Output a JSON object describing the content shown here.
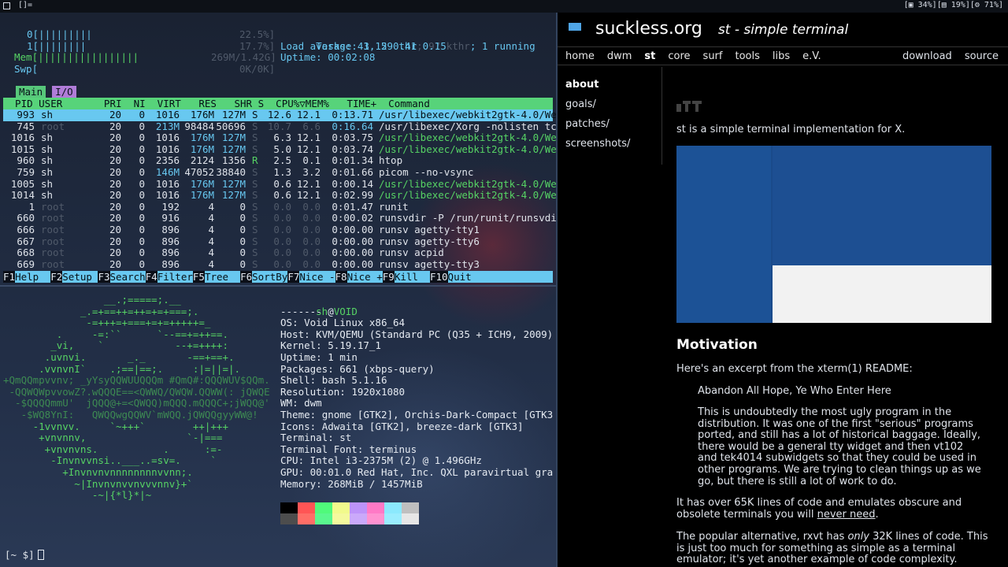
{
  "topbar": {
    "tag_label": "[]=",
    "status": "[▣ 34%][▤ 19%][⚙ 71%]"
  },
  "htop": {
    "cpu0": "0[|||||||||",
    "cpu0_val": "22.5%]",
    "cpu1": "1[||||||||",
    "cpu1_val": "17.7%]",
    "mem": "Mem[|||||||||||||||||",
    "mem_val": "269M/1.42G]",
    "swp": "Swp[",
    "swp_val": "0K/0K]",
    "tasks": "Tasks: 43, 29 thr",
    "tasks_dim": "; 97 kthr",
    "tasks_run": "; 1 running",
    "load": "Load average: 1.15 0.41 0.15",
    "uptime": "Uptime: 00:02:08",
    "tab_main": "Main",
    "tab_io": "I/O",
    "header": "  PID USER       PRI  NI  VIRT   RES   SHR S  CPU%▽MEM%   TIME+  Command",
    "rows": [
      {
        "pid": "993",
        "user": "sh",
        "pri": "20",
        "ni": "0",
        "virt": "1016",
        "res": "176M",
        "shr": "127M",
        "s": "S",
        "cpu": "12.6",
        "mem": "12.1",
        "time": "0:13.71",
        "cmd": "/usr/libexec/webkit2gtk-4.0/We",
        "sel": true
      },
      {
        "pid": "745",
        "user": "root",
        "pri": "20",
        "ni": "0",
        "virt": "213M",
        "res": "98484",
        "shr": "50696",
        "s": "S",
        "cpu": "10.7",
        "mem": "6.6",
        "time": "0:16.64",
        "cmd": "/usr/libexec/Xorg -nolisten tc"
      },
      {
        "pid": "1016",
        "user": "sh",
        "pri": "20",
        "ni": "0",
        "virt": "1016",
        "res": "176M",
        "shr": "127M",
        "s": "S",
        "cpu": "6.3",
        "mem": "12.1",
        "time": "0:03.75",
        "cmd": "/usr/libexec/webkit2gtk-4.0/We"
      },
      {
        "pid": "1015",
        "user": "sh",
        "pri": "20",
        "ni": "0",
        "virt": "1016",
        "res": "176M",
        "shr": "127M",
        "s": "S",
        "cpu": "5.0",
        "mem": "12.1",
        "time": "0:03.74",
        "cmd": "/usr/libexec/webkit2gtk-4.0/We"
      },
      {
        "pid": "960",
        "user": "sh",
        "pri": "20",
        "ni": "0",
        "virt": "2356",
        "res": "2124",
        "shr": "1356",
        "s": "R",
        "cpu": "2.5",
        "mem": "0.1",
        "time": "0:01.34",
        "cmd": "htop"
      },
      {
        "pid": "759",
        "user": "sh",
        "pri": "20",
        "ni": "0",
        "virt": "146M",
        "res": "47052",
        "shr": "38840",
        "s": "S",
        "cpu": "1.3",
        "mem": "3.2",
        "time": "0:01.66",
        "cmd": "picom --no-vsync"
      },
      {
        "pid": "1005",
        "user": "sh",
        "pri": "20",
        "ni": "0",
        "virt": "1016",
        "res": "176M",
        "shr": "127M",
        "s": "S",
        "cpu": "0.6",
        "mem": "12.1",
        "time": "0:00.14",
        "cmd": "/usr/libexec/webkit2gtk-4.0/We"
      },
      {
        "pid": "1014",
        "user": "sh",
        "pri": "20",
        "ni": "0",
        "virt": "1016",
        "res": "176M",
        "shr": "127M",
        "s": "S",
        "cpu": "0.6",
        "mem": "12.1",
        "time": "0:02.99",
        "cmd": "/usr/libexec/webkit2gtk-4.0/We"
      },
      {
        "pid": "1",
        "user": "root",
        "pri": "20",
        "ni": "0",
        "virt": "192",
        "res": "4",
        "shr": "0",
        "s": "S",
        "cpu": "0.0",
        "mem": "0.0",
        "time": "0:01.47",
        "cmd": "runit"
      },
      {
        "pid": "660",
        "user": "root",
        "pri": "20",
        "ni": "0",
        "virt": "916",
        "res": "4",
        "shr": "0",
        "s": "S",
        "cpu": "0.0",
        "mem": "0.0",
        "time": "0:00.02",
        "cmd": "runsvdir -P /run/runit/runsvdi"
      },
      {
        "pid": "666",
        "user": "root",
        "pri": "20",
        "ni": "0",
        "virt": "896",
        "res": "4",
        "shr": "0",
        "s": "S",
        "cpu": "0.0",
        "mem": "0.0",
        "time": "0:00.00",
        "cmd": "runsv agetty-tty1"
      },
      {
        "pid": "667",
        "user": "root",
        "pri": "20",
        "ni": "0",
        "virt": "896",
        "res": "4",
        "shr": "0",
        "s": "S",
        "cpu": "0.0",
        "mem": "0.0",
        "time": "0:00.00",
        "cmd": "runsv agetty-tty6"
      },
      {
        "pid": "668",
        "user": "root",
        "pri": "20",
        "ni": "0",
        "virt": "896",
        "res": "4",
        "shr": "0",
        "s": "S",
        "cpu": "0.0",
        "mem": "0.0",
        "time": "0:00.00",
        "cmd": "runsv acpid"
      },
      {
        "pid": "669",
        "user": "root",
        "pri": "20",
        "ni": "0",
        "virt": "896",
        "res": "4",
        "shr": "0",
        "s": "S",
        "cpu": "0.0",
        "mem": "0.0",
        "time": "0:00.00",
        "cmd": "runsv agetty-tty3"
      }
    ],
    "fkeys": [
      {
        "k": "F1",
        "l": "Help  "
      },
      {
        "k": "F2",
        "l": "Setup "
      },
      {
        "k": "F3",
        "l": "Search"
      },
      {
        "k": "F4",
        "l": "Filter"
      },
      {
        "k": "F5",
        "l": "Tree  "
      },
      {
        "k": "F6",
        "l": "SortBy"
      },
      {
        "k": "F7",
        "l": "Nice -"
      },
      {
        "k": "F8",
        "l": "Nice +"
      },
      {
        "k": "F9",
        "l": "Kill  "
      },
      {
        "k": "F10",
        "l": "Quit"
      }
    ]
  },
  "neofetch": {
    "logo": [
      "                 __.;=====;.__",
      "             _.=+==++=++=+=+===;.",
      "              -=+++=+===+=+=+++++=_",
      "         .     -=:``      `--==+=++==.",
      "        _vi,    `            --+=++++:",
      "       .uvnvi.       _._       -==+==+.",
      "      .vvnvnI`    .;==|==;.     :|=||=|.",
      "+QmQQmpvvnv; _yYsyQQWUUQQQm #QmQ#:QQQWUV$QQm.",
      " -QQWQWpvvowZ?.wQQQE==<QWWQ/QWQW.QQWW(: jQWQE",
      "  -$QQQQmmU'  jQQQ@+=<QWQQ)mQQQ.mQQQC+;jWQQ@'",
      "   -$WQ8YnI:   QWQQwgQQWV`mWQQ.jQWQQgyyWW@!",
      "     -1vvnvv.     `~+++`        ++|+++",
      "      +vnvnnv,                 `-|===",
      "       +vnvnvns.           .      :=-",
      "        -Invnvvnsi..___..=sv=.     `",
      "          +Invnvnvnnnnnnnnvvnn;.",
      "            ~|Invnvnvvnvvvnnv}+`",
      "               -~|{*l}*|~"
    ],
    "user": "sh",
    "at": "@",
    "host": "VOID",
    "underline": "-------",
    "lines": [
      [
        "OS",
        "Void Linux x86_64"
      ],
      [
        "Host",
        "KVM/QEMU (Standard PC (Q35 + ICH9, 2009)"
      ],
      [
        "Kernel",
        "5.19.17_1"
      ],
      [
        "Uptime",
        "1 min"
      ],
      [
        "Packages",
        "661 (xbps-query)"
      ],
      [
        "Shell",
        "bash 5.1.16"
      ],
      [
        "Resolution",
        "1920x1080"
      ],
      [
        "WM",
        "dwm"
      ],
      [
        "Theme",
        "gnome [GTK2], Orchis-Dark-Compact [GTK3"
      ],
      [
        "Icons",
        "Adwaita [GTK2], breeze-dark [GTK3]"
      ],
      [
        "Terminal",
        "st"
      ],
      [
        "Terminal Font",
        "terminus"
      ],
      [
        "CPU",
        "Intel i3-2375M (2) @ 1.496GHz"
      ],
      [
        "GPU",
        "00:01.0 Red Hat, Inc. QXL paravirtual gra"
      ],
      [
        "Memory",
        "268MiB / 1457MiB"
      ]
    ],
    "palette_top": [
      "#000000",
      "#ff5555",
      "#50fa7b",
      "#f1fa8c",
      "#bd93f9",
      "#ff79c6",
      "#8be9fd",
      "#bfbfbf"
    ],
    "palette_bottom": [
      "#4d4d4d",
      "#ff6e67",
      "#5af78e",
      "#f4f99d",
      "#caa9fa",
      "#ff92d0",
      "#9aedfe",
      "#e6e6e6"
    ],
    "prompt": "[~ $]"
  },
  "browser": {
    "site": "suckless.org",
    "subtitle": "st - simple terminal",
    "menu": [
      "home",
      "dwm",
      "st",
      "core",
      "surf",
      "tools",
      "libs",
      "e.V."
    ],
    "menu_active": "st",
    "menu_right": [
      "download",
      "source"
    ],
    "side": [
      "about",
      "goals/",
      "patches/",
      "screenshots/"
    ],
    "intro": "st is a simple terminal implementation for X.",
    "heading": "Motivation",
    "p_excerpt": "Here's an excerpt from the xterm(1) README:",
    "quote1": "Abandon All Hope, Ye Who Enter Here",
    "quote2": "This is undoubtedly the most ugly program in the distribution. It was one of the first \"serious\" programs ported, and still has a lot of historical baggage. Ideally, there would be a general tty widget and then vt102 and tek4014 subwidgets so that they could be used in other programs. We are trying to clean things up as we go, but there is still a lot of work to do.",
    "p3_a": "It has over 65K lines of code and emulates obscure and obsolete terminals you will ",
    "p3_link": "never need",
    "p3_b": ".",
    "p4_a": "The popular alternative, rxvt has ",
    "p4_em": "only",
    "p4_b": " 32K lines of code. This is just too much for something as simple as a terminal emulator; it's yet another example of code complexity."
  }
}
